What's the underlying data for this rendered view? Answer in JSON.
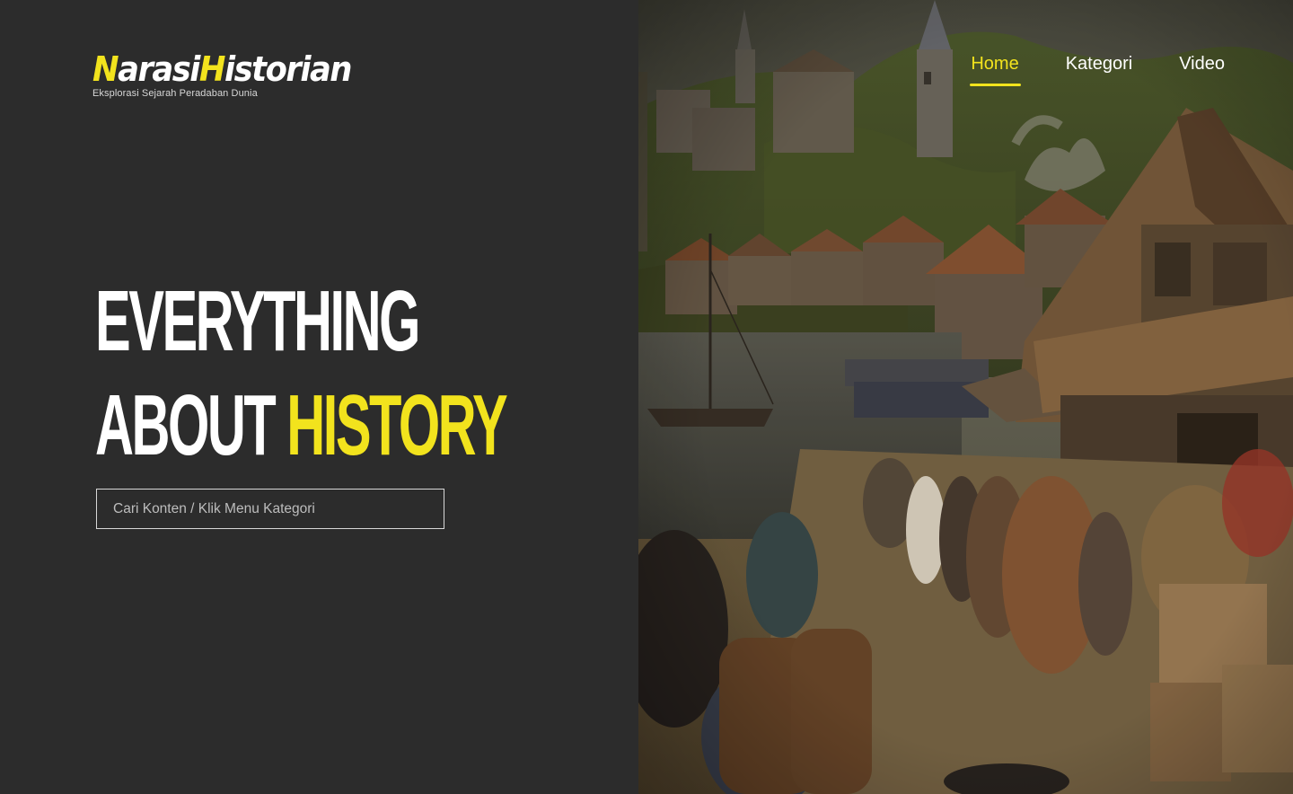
{
  "brand": {
    "logo_part1_accent": "N",
    "logo_part1_rest": "arasi",
    "logo_part2_accent": "H",
    "logo_part2_rest": "istorian",
    "tagline": "Eksplorasi Sejarah Peradaban Dunia"
  },
  "nav": {
    "items": [
      {
        "label": "Home",
        "active": true
      },
      {
        "label": "Kategori",
        "active": false
      },
      {
        "label": "Video",
        "active": false
      }
    ]
  },
  "hero": {
    "line1": "EVERYTHING",
    "line2_white": "ABOUT",
    "line2_highlight": "HISTORY"
  },
  "search": {
    "placeholder": "Cari Konten / Klik Menu Kategori",
    "value": ""
  },
  "colors": {
    "accent": "#f2e31d",
    "panel_bg": "#2c2c2c",
    "text": "#ffffff"
  }
}
